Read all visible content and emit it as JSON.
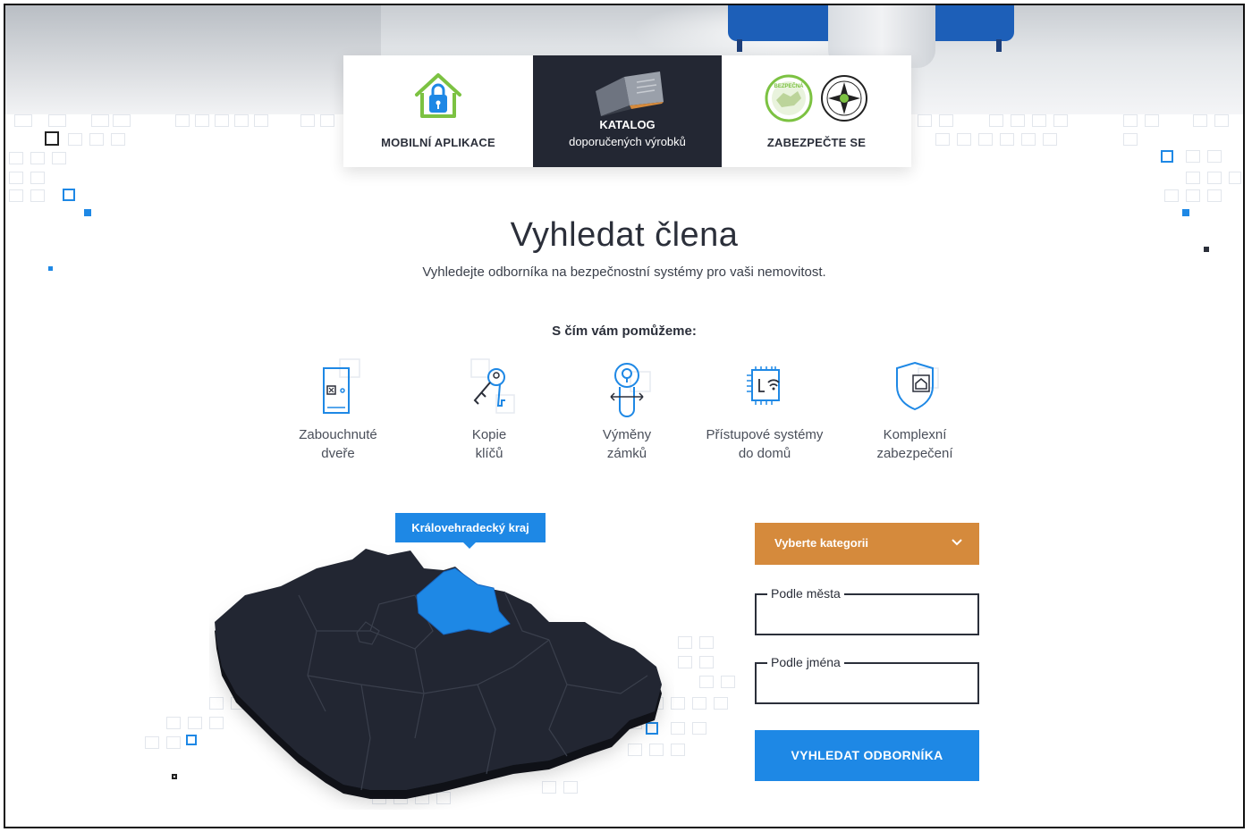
{
  "top_cards": {
    "mobile": {
      "label": "MOBILNÍ APLIKACE",
      "icon": "house-lock-icon"
    },
    "catalog": {
      "title": "KATALOG",
      "subtitle": "doporučených výrobků",
      "icon": "catalog-book-icon"
    },
    "secure": {
      "label": "ZABEZPEČTE SE",
      "icon": "certification-badges-icon"
    }
  },
  "page": {
    "title": "Vyhledat člena",
    "subtitle": "Vyhledejte odborníka na bezpečnostní systémy pro vaši nemovitost.",
    "help_heading": "S čím vám pomůžeme:"
  },
  "services": [
    {
      "line1": "Zabouchnuté",
      "line2": "dveře",
      "icon": "locked-door-icon"
    },
    {
      "line1": "Kopie",
      "line2": "klíčů",
      "icon": "keys-icon"
    },
    {
      "line1": "Výměny",
      "line2": "zámků",
      "icon": "lock-cylinder-icon"
    },
    {
      "line1": "Přístupové systémy",
      "line2": "do domů",
      "icon": "access-system-icon"
    },
    {
      "line1": "Komplexní",
      "line2": "zabezpečení",
      "icon": "shield-home-icon"
    }
  ],
  "map": {
    "selected_region": "Královehradecký kraj",
    "region_color": "#1e88e5",
    "land_color": "#232733"
  },
  "form": {
    "category_select": "Vyberte kategorii",
    "city_label": "Podle města",
    "city_value": "",
    "name_label": "Podle jména",
    "name_value": "",
    "submit_label": "VYHLEDAT ODBORNÍKA"
  },
  "colors": {
    "accent": "#1e88e5",
    "orange": "#d58a3c",
    "dark": "#232733"
  }
}
